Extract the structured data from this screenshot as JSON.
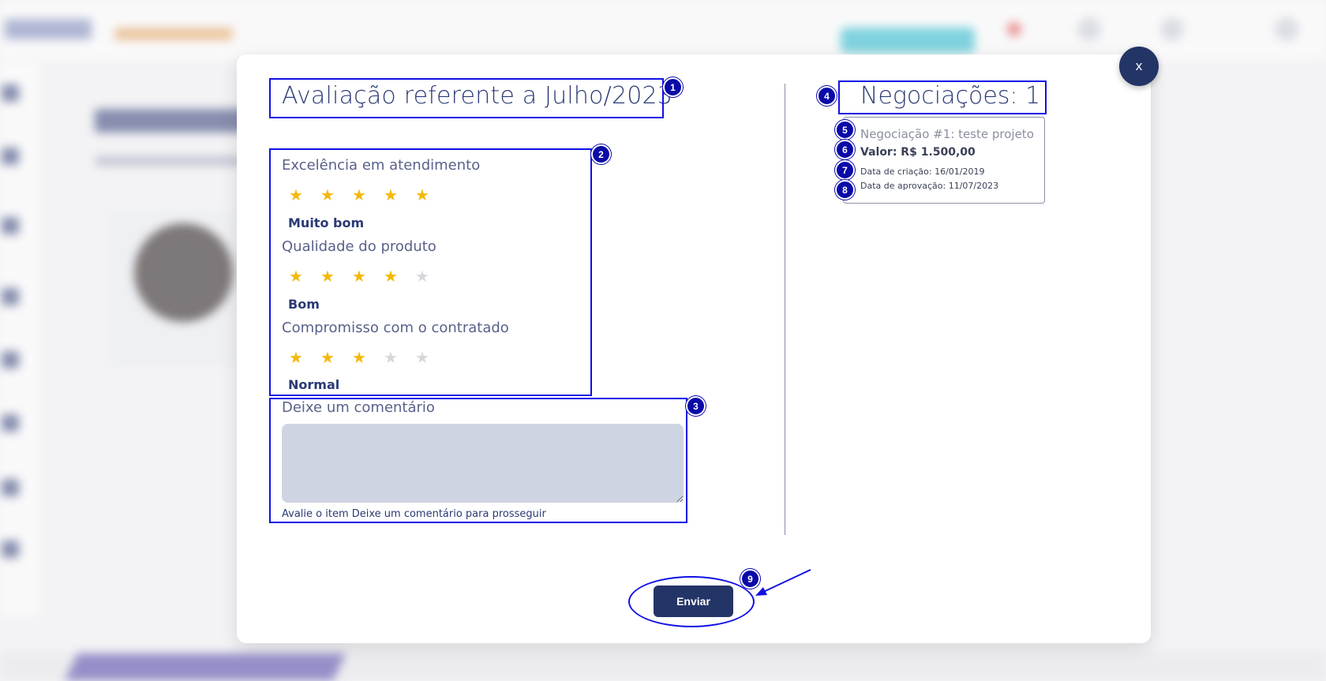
{
  "modal": {
    "title": "Avaliação referente a Julho/2023",
    "close_label": "x",
    "criteria": [
      {
        "label": "Excelência em atendimento",
        "rating": 5,
        "rating_text": "Muito bom"
      },
      {
        "label": "Qualidade do produto",
        "rating": 4,
        "rating_text": "Bom"
      },
      {
        "label": "Compromisso com o contratado",
        "rating": 3,
        "rating_text": "Normal"
      }
    ],
    "max_rating": 5,
    "comment": {
      "label": "Deixe um comentário",
      "value": "",
      "hint": "Avalie o item Deixe um comentário para prosseguir"
    },
    "negotiations": {
      "title": "Negociações: 1",
      "items": [
        {
          "name": "Negociação #1: teste projeto",
          "value": "Valor: R$ 1.500,00",
          "created": "Data de criação: 16/01/2019",
          "approved": "Data de aprovação: 11/07/2023"
        }
      ]
    },
    "submit_label": "Enviar"
  },
  "annotations": {
    "badges": [
      "1",
      "2",
      "3",
      "4",
      "5",
      "6",
      "7",
      "8",
      "9"
    ],
    "box_color": "#1010e6",
    "badge_color": "#0a0aa8"
  },
  "colors": {
    "primary": "#233466",
    "title_text": "#2b3a75",
    "star_on": "#f2b90a",
    "star_off": "#d6d7db",
    "comment_bg": "#cfd4e3"
  }
}
